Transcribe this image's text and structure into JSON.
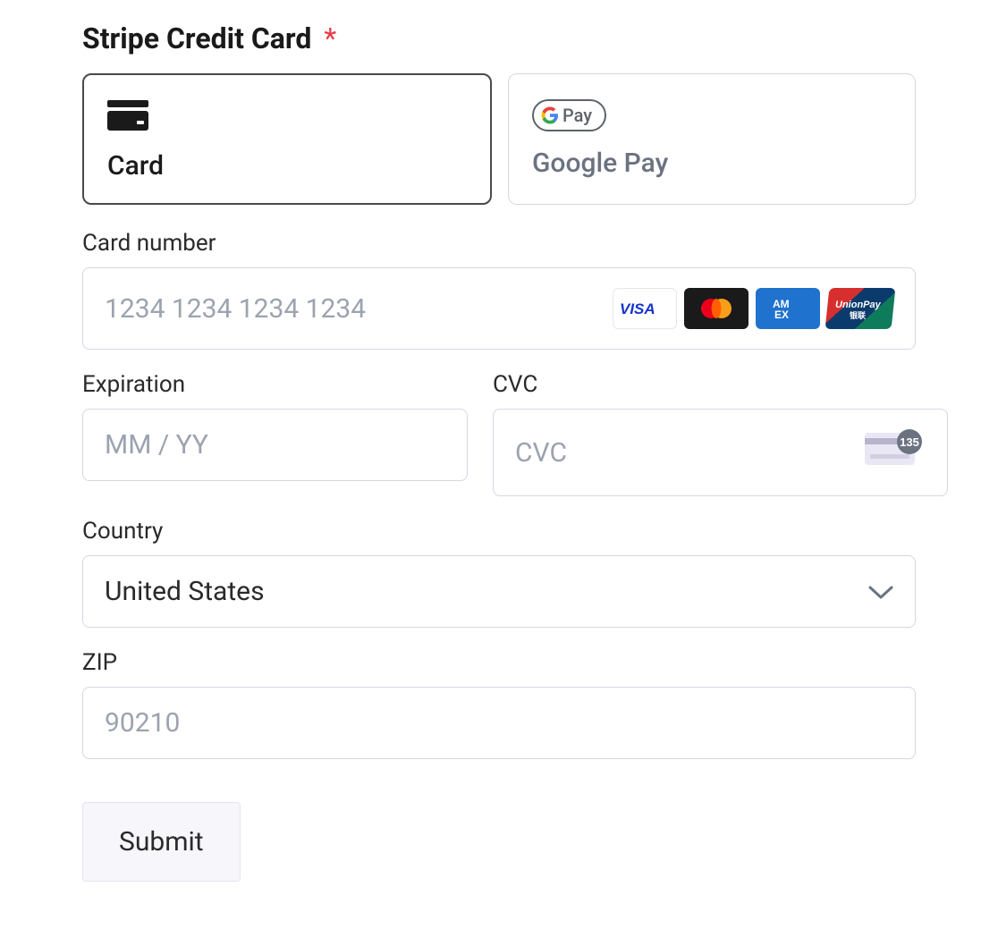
{
  "heading": "Stripe Credit Card",
  "required_mark": "*",
  "payment_methods": {
    "card": {
      "label": "Card",
      "selected": true
    },
    "gpay": {
      "label": "Google Pay",
      "pill_text": "Pay",
      "selected": false
    }
  },
  "card_number": {
    "label": "Card number",
    "placeholder": "1234 1234 1234 1234",
    "value": "",
    "brands": [
      "VISA",
      "Mastercard",
      "Amex",
      "UnionPay"
    ]
  },
  "expiration": {
    "label": "Expiration",
    "placeholder": "MM / YY",
    "value": ""
  },
  "cvc": {
    "label": "CVC",
    "placeholder": "CVC",
    "hint_digits": "135",
    "value": ""
  },
  "country": {
    "label": "Country",
    "selected": "United States"
  },
  "zip": {
    "label": "ZIP",
    "placeholder": "90210",
    "value": ""
  },
  "submit_label": "Submit"
}
